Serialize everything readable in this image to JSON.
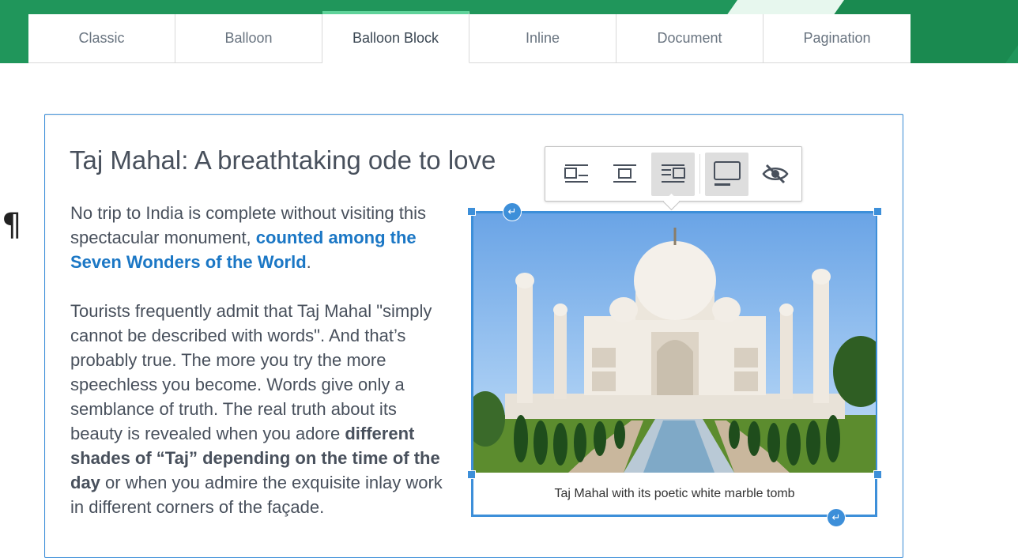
{
  "tabs": [
    "Classic",
    "Balloon",
    "Balloon Block",
    "Inline",
    "Document",
    "Pagination"
  ],
  "active_tab": "Balloon Block",
  "pilcrow": "¶",
  "article": {
    "title": "Taj Mahal: A breathtaking ode to love",
    "p1_a": "No trip to India is complete without visiting this spectacular monument, ",
    "p1_link": "counted among the Seven Wonders of the World",
    "p1_b": ".",
    "p2_a": "Tourists frequently admit that Taj Mahal \"simply cannot be described with words\". And that’s probably true. The more you try the more speechless you become. Words give only a semblance of truth. The real truth about its beauty is revealed when you adore ",
    "p2_bold": "different shades of “Taj” depending on the time of the day",
    "p2_b": " or when you admire the exquisite inlay work in different corners of the façade."
  },
  "image": {
    "caption": "Taj Mahal with its poetic white marble tomb"
  },
  "toolbar": {
    "buttons": [
      "align-left-wrap-icon",
      "align-center-icon",
      "align-right-wrap-icon",
      "toggle-caption-icon",
      "hide-icon"
    ]
  },
  "colors": {
    "hero": "#20965b",
    "accent": "#3d8fd9",
    "link": "#1b77c5",
    "text": "#48505c"
  }
}
